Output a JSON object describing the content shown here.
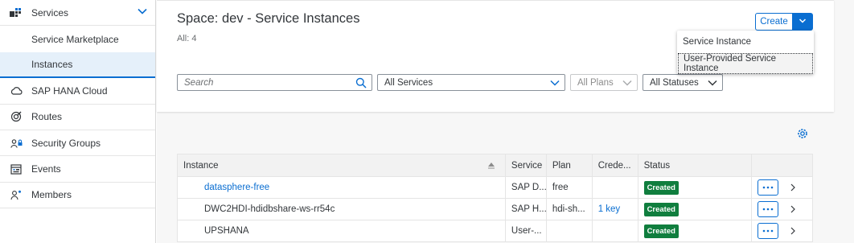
{
  "sidebar": {
    "items": [
      {
        "label": "Services",
        "icon": "services-icon",
        "expanded": true
      },
      {
        "label": "Service Marketplace",
        "sub": true
      },
      {
        "label": "Instances",
        "sub": true,
        "selected": true
      },
      {
        "label": "SAP HANA Cloud",
        "icon": "cloud-icon"
      },
      {
        "label": "Routes",
        "icon": "routes-icon"
      },
      {
        "label": "Security Groups",
        "icon": "security-groups-icon"
      },
      {
        "label": "Events",
        "icon": "events-icon"
      },
      {
        "label": "Members",
        "icon": "members-icon"
      }
    ]
  },
  "header": {
    "title": "Space: dev - Service Instances",
    "count": "All: 4",
    "create_label": "Create",
    "menu_items": [
      "Service Instance",
      "User-Provided Service Instance"
    ]
  },
  "filters": {
    "search_placeholder": "Search",
    "services": "All Services",
    "plans": "All Plans",
    "statuses": "All Statuses"
  },
  "table": {
    "columns": [
      "Instance",
      "Service",
      "Plan",
      "Crede...",
      "Status"
    ],
    "rows": [
      {
        "instance": "datasphere-free",
        "instance_link": true,
        "service": "SAP D...",
        "plan": "free",
        "credentials": "",
        "status": "Created"
      },
      {
        "instance": "DWC2HDI-hdidbshare-ws-rr54c",
        "instance_link": false,
        "service": "SAP H...",
        "plan": "hdi-sh...",
        "credentials": "1 key",
        "status": "Created"
      },
      {
        "instance": "UPSHANA",
        "instance_link": false,
        "service": "User-...",
        "plan": "",
        "credentials": "",
        "status": "Created"
      }
    ]
  },
  "colors": {
    "accent": "#0a6ed1",
    "status_created": "#107e3e",
    "selected_bg": "#e5f0fa"
  }
}
